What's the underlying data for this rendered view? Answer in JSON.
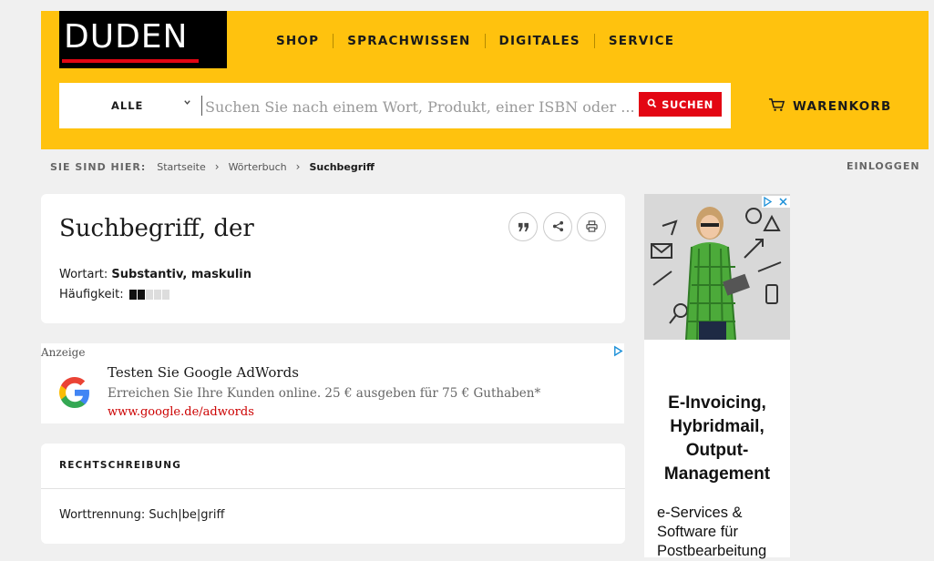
{
  "header": {
    "logo": "DUDEN",
    "nav": [
      "SHOP",
      "SPRACHWISSEN",
      "DIGITALES",
      "SERVICE"
    ],
    "search": {
      "category": "ALLE",
      "placeholder": "Suchen Sie nach einem Wort, Produkt, einer ISBN oder ...",
      "button_label": "SUCHEN"
    },
    "cart_label": "WARENKORB"
  },
  "breadcrumb": {
    "lead": "SIE SIND HIER:",
    "items": [
      "Startseite",
      "Wörterbuch",
      "Suchbegriff"
    ]
  },
  "login_label": "EINLOGGEN",
  "entry": {
    "title": "Suchbegriff, der",
    "wortart_label": "Wortart:",
    "wortart_value": "Substantiv, maskulin",
    "frequency_label": "Häufigkeit:",
    "frequency_level": 2,
    "frequency_max": 5
  },
  "ad": {
    "label": "Anzeige",
    "headline": "Testen Sie Google AdWords",
    "description": "Erreichen Sie Ihre Kunden online. 25 € ausgeben für 75 € Guthaben*",
    "url": "www.google.de/adwords"
  },
  "rechtschreibung": {
    "heading": "RECHTSCHREIBUNG",
    "worttrennung": "Worttrennung: Such|be|griff"
  },
  "side_ad": {
    "headline": "E-Invoicing,\nHybridmail,\nOutput-\nManagement",
    "subtext": "e-Services &\nSoftware für\nPostbearbeitung"
  },
  "colors": {
    "header_yellow": "#ffc20e",
    "accent_red": "#e30613",
    "ad_url": "#cc0000"
  }
}
